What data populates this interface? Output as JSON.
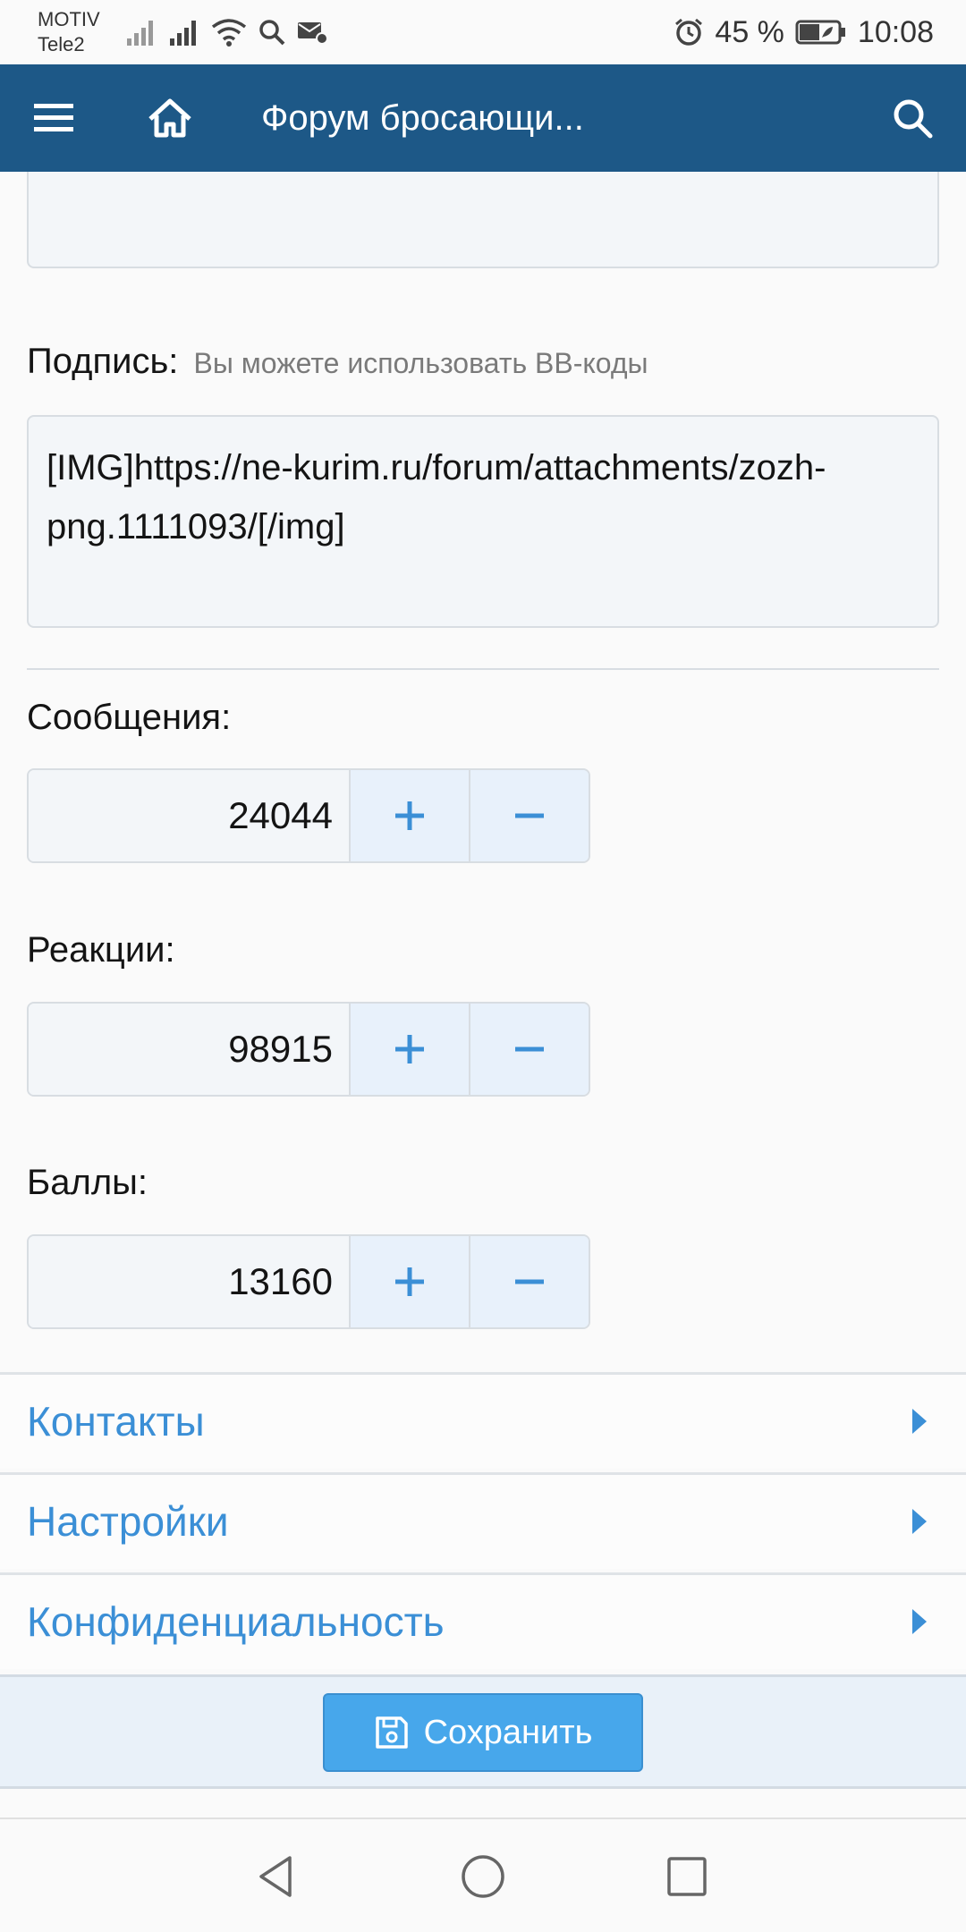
{
  "status_bar": {
    "carrier_1": "MOTIV",
    "carrier_2": "Tele2",
    "battery": "45 %",
    "time": "10:08",
    "icons": [
      "signal-icon",
      "signal-icon",
      "wifi-icon",
      "search-icon",
      "mail-settings-icon",
      "alarm-icon",
      "battery-icon"
    ]
  },
  "header": {
    "title": "Форум бросающи...",
    "icons": [
      "menu-icon",
      "home-icon",
      "search-icon"
    ]
  },
  "form": {
    "signature_label": "Подпись:",
    "signature_hint": "Вы можете использовать BB-коды",
    "signature_value": "[IMG]https://ne-kurim.ru/forum/attachments/zozh-png.1111093/[/img]",
    "fields": [
      {
        "label": "Сообщения:",
        "value": "24044"
      },
      {
        "label": "Реакции:",
        "value": "98915"
      },
      {
        "label": "Баллы:",
        "value": "13160"
      }
    ]
  },
  "sections": [
    {
      "label": "Контакты"
    },
    {
      "label": "Настройки"
    },
    {
      "label": "Конфиденциальность"
    }
  ],
  "save_button": {
    "label": "Сохранить",
    "icon": "floppy-disk-icon"
  },
  "navbar": {
    "icons": [
      "back-icon",
      "home-circle-icon",
      "recent-apps-icon"
    ]
  },
  "colors": {
    "header_bg": "#1d5887",
    "accent": "#3b8fd6",
    "button_bg": "#47a7eb"
  }
}
